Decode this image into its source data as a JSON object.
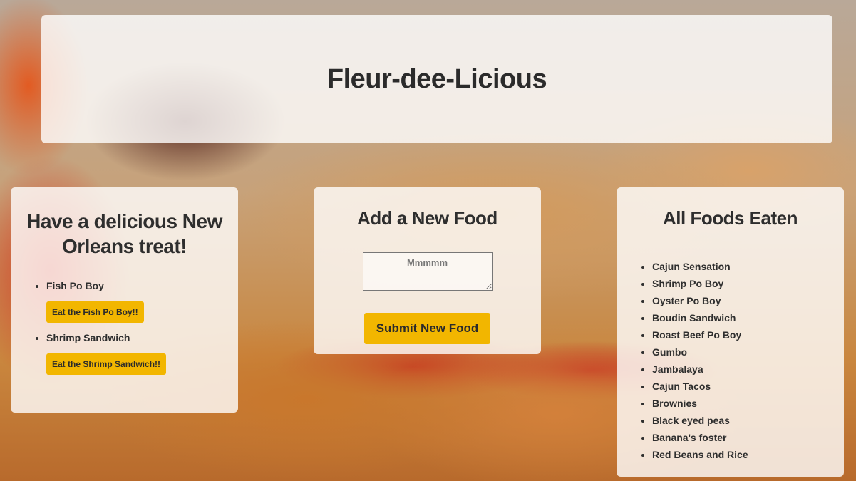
{
  "header": {
    "title": "Fleur-dee-Licious"
  },
  "treat": {
    "heading": "Have a delicious New Orleans treat!",
    "items": [
      {
        "label": "Fish Po Boy",
        "button": "Eat the Fish Po Boy!!"
      },
      {
        "label": "Shrimp Sandwich",
        "button": "Eat the Shrimp Sandwich!!"
      }
    ]
  },
  "add_food": {
    "heading": "Add a New Food",
    "input_placeholder": "Mmmmm",
    "input_value": "",
    "submit_label": "Submit New Food"
  },
  "eaten": {
    "heading": "All Foods Eaten",
    "items": [
      "Cajun Sensation",
      "Shrimp Po Boy",
      "Oyster Po Boy",
      "Boudin Sandwich",
      "Roast Beef Po Boy",
      "Gumbo",
      "Jambalaya",
      "Cajun Tacos",
      "Brownies",
      "Black eyed peas",
      "Banana's foster",
      "Red Beans and Rice"
    ]
  },
  "colors": {
    "accent": "#f2b600",
    "text": "#2e2e2e",
    "panel": "#ffffff"
  }
}
